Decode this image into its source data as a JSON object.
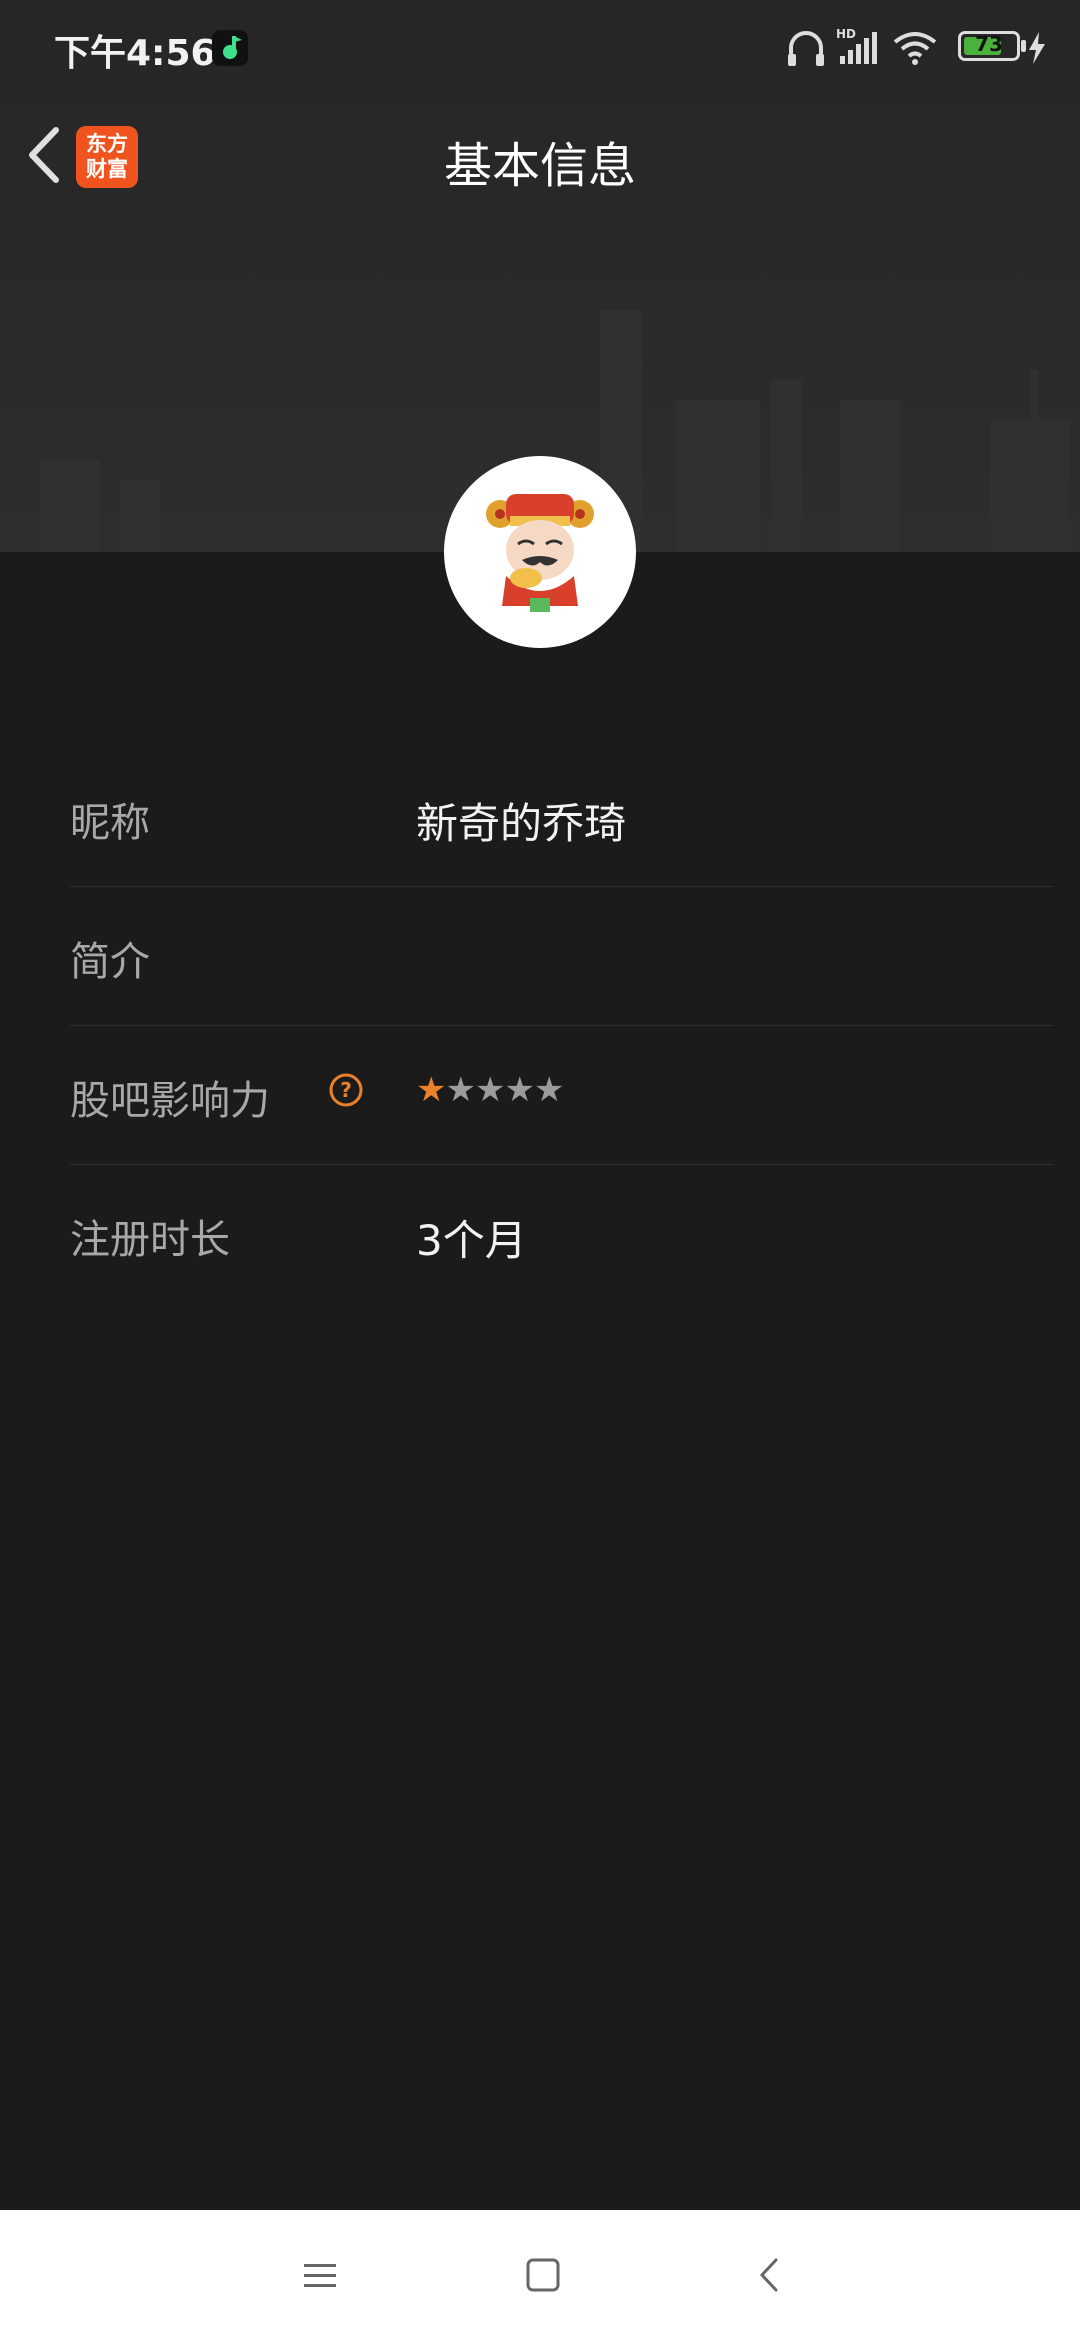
{
  "status_bar": {
    "time": "下午4:56",
    "battery": "73",
    "battery_level": 0.73,
    "icons": [
      "music-app-icon",
      "headphones-icon",
      "hd-signal-icon",
      "wifi-icon",
      "battery-icon",
      "charging-icon"
    ]
  },
  "header": {
    "title": "基本信息",
    "logo_line1": "东方",
    "logo_line2": "财富"
  },
  "profile": {
    "rows": [
      {
        "label": "昵称",
        "value": "新奇的乔琦"
      },
      {
        "label": "简介",
        "value": ""
      },
      {
        "label": "股吧影响力",
        "rating": 1,
        "rating_max": 5
      },
      {
        "label": "注册时长",
        "value": "3个月"
      }
    ]
  },
  "colors": {
    "background": "#1b1b1b",
    "accent": "#f0541e",
    "help_icon": "#e9822a",
    "star_active": "#e9822a",
    "star_inactive": "#9b9b9b"
  },
  "nav_bar": {
    "icons": [
      "menu-icon",
      "home-square-icon",
      "back-chevron-icon"
    ]
  }
}
